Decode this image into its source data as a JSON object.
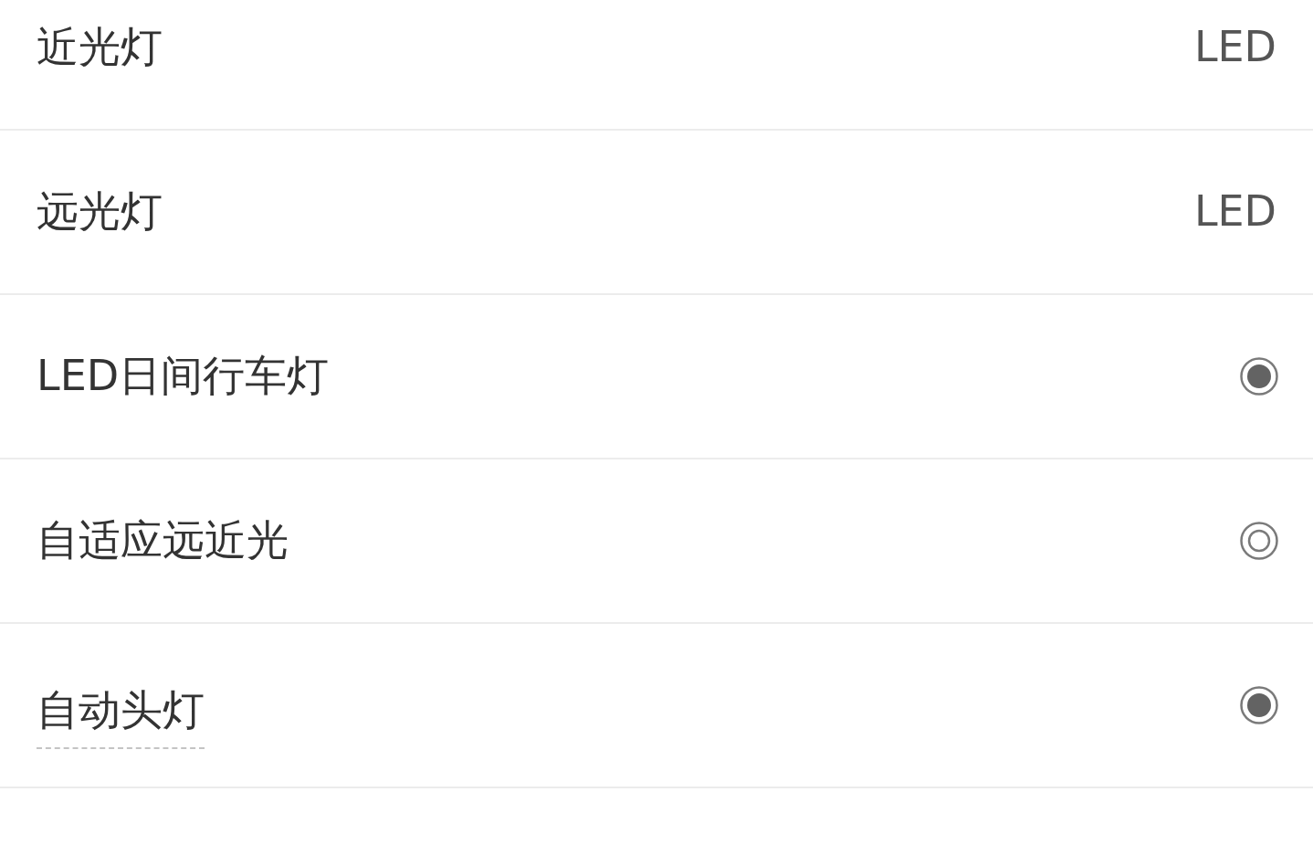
{
  "rows": [
    {
      "label": "近光灯",
      "kind": "text",
      "value": "LED",
      "underlined": false
    },
    {
      "label": "远光灯",
      "kind": "text",
      "value": "LED",
      "underlined": false
    },
    {
      "label": "LED日间行车灯",
      "kind": "indicator",
      "filled": true,
      "underlined": false
    },
    {
      "label": "自适应远近光",
      "kind": "indicator",
      "filled": false,
      "underlined": false
    },
    {
      "label": "自动头灯",
      "kind": "indicator",
      "filled": true,
      "underlined": true
    }
  ]
}
